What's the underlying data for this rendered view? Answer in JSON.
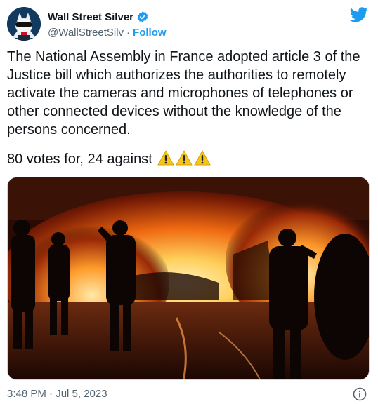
{
  "author": {
    "display_name": "Wall Street Silver",
    "handle": "@WallStreetSilv",
    "separator": "·",
    "follow_label": "Follow",
    "verified": true,
    "avatar_icon": "avatar-wolf-sunglasses-icon"
  },
  "tweet": {
    "text": "The National Assembly in France adopted article 3 of the Justice bill which authorizes the authorities to remotely activate the cameras and microphones of telephones or other connected devices without the knowledge of the persons concerned.",
    "votes_text": "80 votes for, 24 against",
    "emoji_icons": [
      "warning-icon",
      "warning-icon",
      "warning-icon"
    ],
    "media_icon": "burning-street-photo"
  },
  "footer": {
    "timestamp": "3:48 PM · Jul 5, 2023",
    "info_icon": "info-icon"
  },
  "colors": {
    "accent": "#1d9bf0",
    "text": "#0f1419",
    "muted": "#536471",
    "warning": "#f5c518"
  }
}
